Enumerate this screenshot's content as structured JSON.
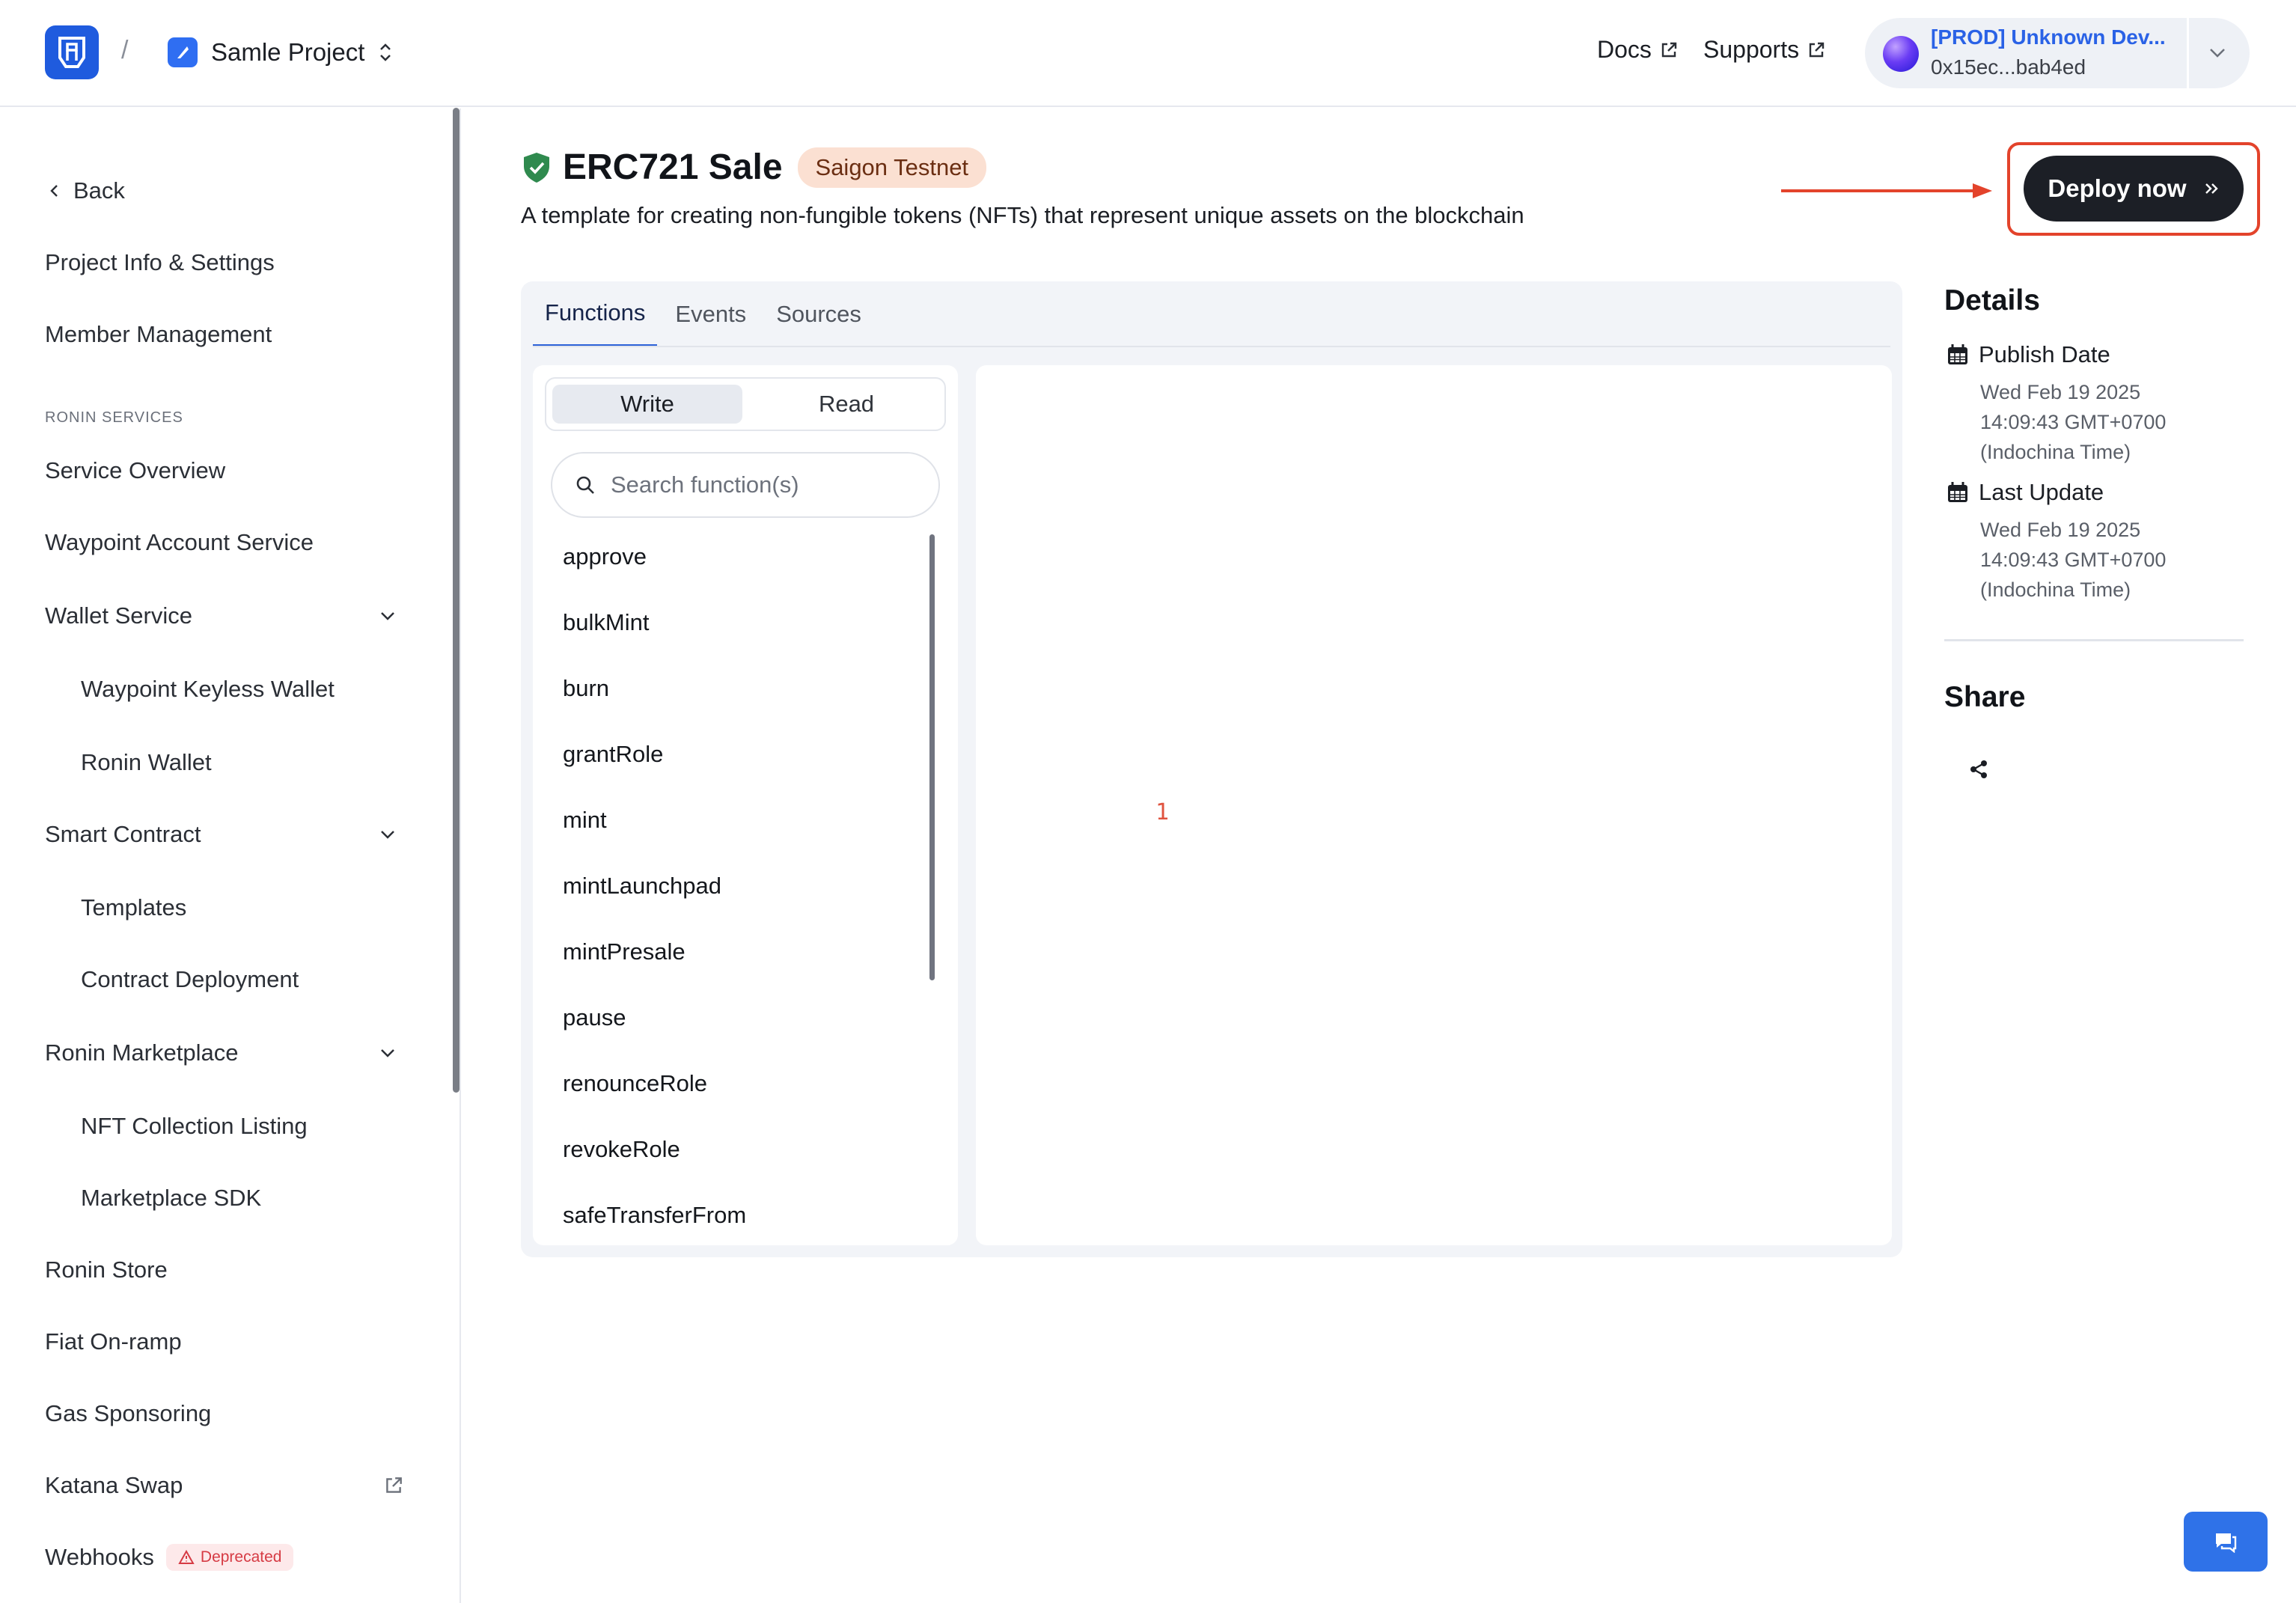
{
  "header": {
    "breadcrumb_sep": "/",
    "project_name": "Samle Project",
    "docs_label": "Docs",
    "supports_label": "Supports",
    "account": {
      "name": "[PROD] Unknown Dev...",
      "address": "0x15ec...bab4ed"
    }
  },
  "sidebar": {
    "back": "Back",
    "project_info": "Project Info & Settings",
    "member_management": "Member Management",
    "section_label": "RONIN SERVICES",
    "service_overview": "Service Overview",
    "waypoint_account": "Waypoint Account Service",
    "wallet_service": "Wallet Service",
    "waypoint_keyless": "Waypoint Keyless Wallet",
    "ronin_wallet": "Ronin Wallet",
    "smart_contract": "Smart Contract",
    "templates": "Templates",
    "contract_deployment": "Contract Deployment",
    "ronin_marketplace": "Ronin Marketplace",
    "nft_collection_listing": "NFT Collection Listing",
    "marketplace_sdk": "Marketplace SDK",
    "ronin_store": "Ronin Store",
    "fiat_onramp": "Fiat On-ramp",
    "gas_sponsoring": "Gas Sponsoring",
    "katana_swap": "Katana Swap",
    "webhooks": "Webhooks",
    "deprecated_badge": "Deprecated"
  },
  "main": {
    "title": "ERC721 Sale",
    "network_badge": "Saigon Testnet",
    "subtitle": "A template for creating non-fungible tokens (NFTs) that represent unique assets on the blockchain",
    "deploy_label": "Deploy now",
    "tabs": [
      "Functions",
      "Events",
      "Sources"
    ],
    "mode_write": "Write",
    "mode_read": "Read",
    "search_placeholder": "Search function(s)",
    "functions": [
      "approve",
      "bulkMint",
      "burn",
      "grantRole",
      "mint",
      "mintLaunchpad",
      "mintPresale",
      "pause",
      "renounceRole",
      "revokeRole",
      "safeTransferFrom"
    ],
    "editor_line_number": "1"
  },
  "details": {
    "title": "Details",
    "publish_label": "Publish Date",
    "publish_lines": [
      "Wed Feb 19 2025",
      "14:09:43 GMT+0700",
      "(Indochina Time)"
    ],
    "update_label": "Last Update",
    "update_lines": [
      "Wed Feb 19 2025",
      "14:09:43 GMT+0700",
      "(Indochina Time)"
    ],
    "share_title": "Share"
  },
  "colors": {
    "accent": "#2f6ef2",
    "annotation": "#e3432b",
    "deploy_bg": "#1c1f26",
    "badge_bg": "#fbe0d2"
  }
}
